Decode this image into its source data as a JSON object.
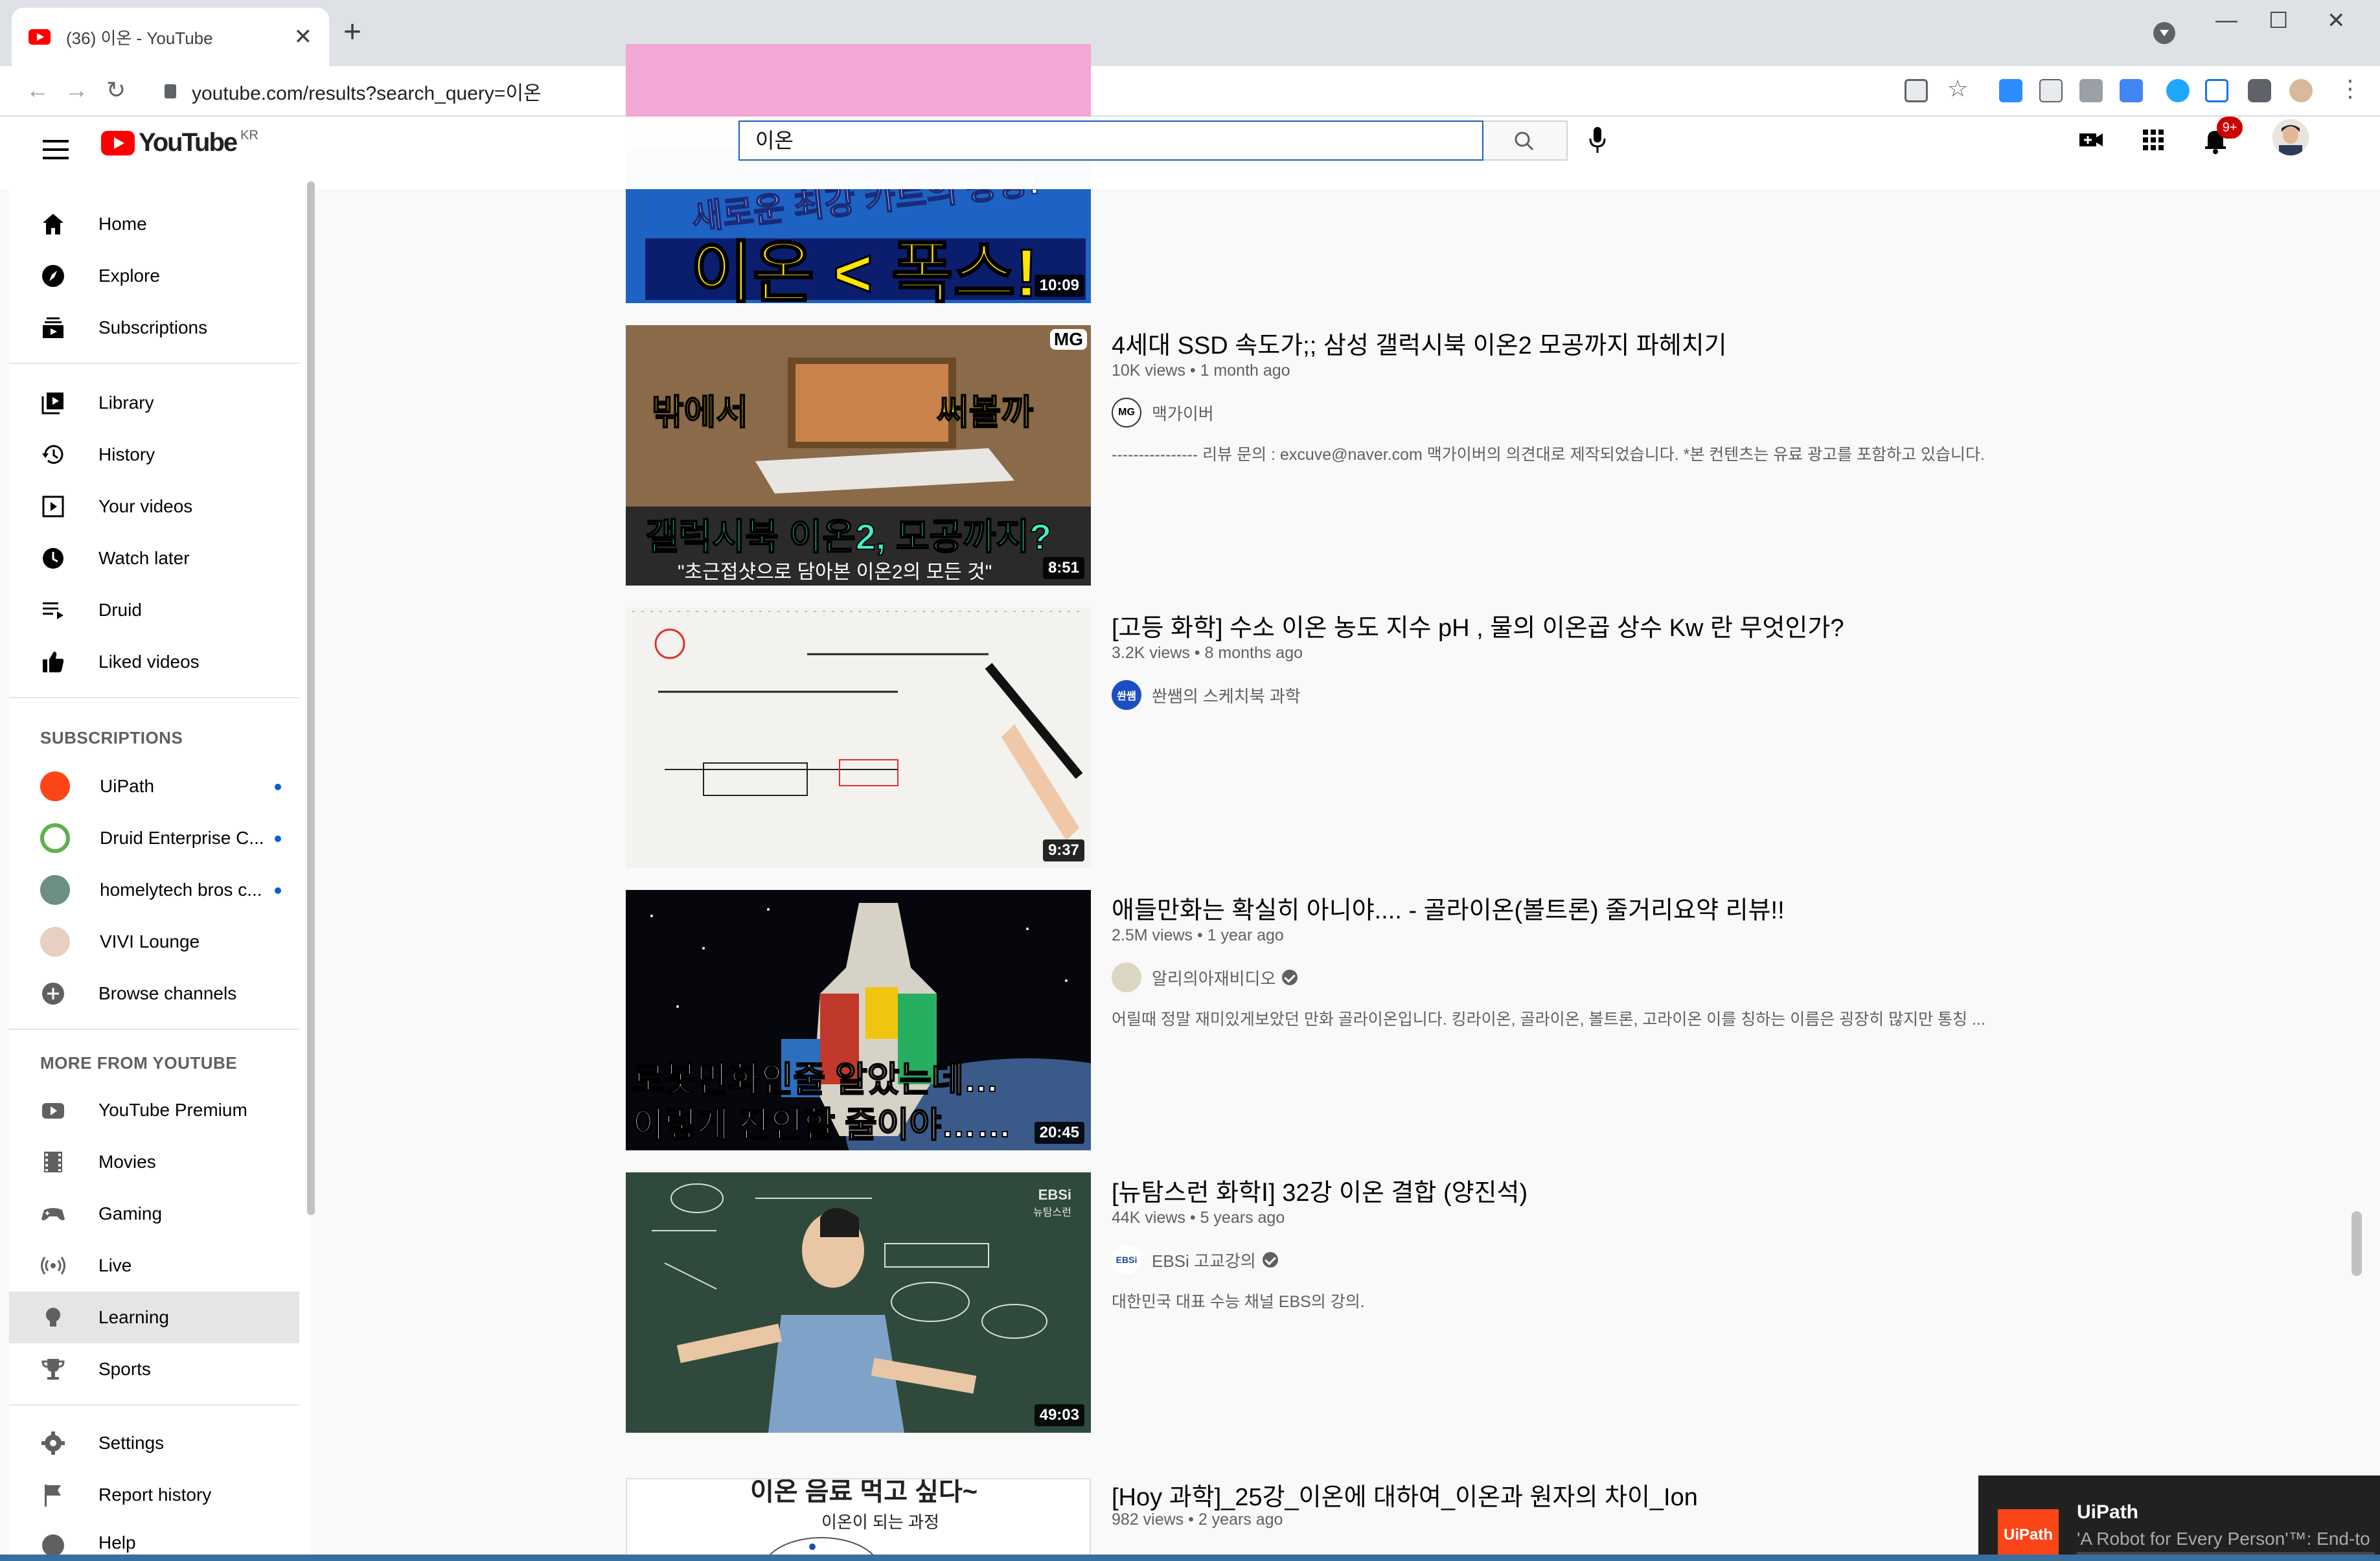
{
  "browser": {
    "tab_title": "(36) 이온 - YouTube",
    "tab_close": "✕",
    "new_tab": "+",
    "url": "youtube.com/results?search_query=이온",
    "minimize": "—",
    "maximize": "☐",
    "close": "✕"
  },
  "masthead": {
    "logo_text": "YouTube",
    "region": "KR",
    "search_value": "이온",
    "notification_count": "9+"
  },
  "sidebar": {
    "main": [
      {
        "label": "Home",
        "icon": "home-icon"
      },
      {
        "label": "Explore",
        "icon": "compass-icon"
      },
      {
        "label": "Subscriptions",
        "icon": "subscriptions-icon"
      }
    ],
    "library": [
      {
        "label": "Library",
        "icon": "library-icon"
      },
      {
        "label": "History",
        "icon": "history-icon"
      },
      {
        "label": "Your videos",
        "icon": "your-videos-icon"
      },
      {
        "label": "Watch later",
        "icon": "clock-icon"
      },
      {
        "label": "Druid",
        "icon": "playlist-icon"
      },
      {
        "label": "Liked videos",
        "icon": "thumbs-up-icon"
      }
    ],
    "subscriptions_heading": "SUBSCRIPTIONS",
    "subscriptions": [
      {
        "label": "UiPath",
        "new": true,
        "color": "#fa4616"
      },
      {
        "label": "Druid Enterprise C...",
        "new": true,
        "color": "#5fb04d"
      },
      {
        "label": "homelytech bros c...",
        "new": true,
        "color": "#6b8f80"
      },
      {
        "label": "VIVI Lounge",
        "new": false,
        "color": "#e7cfc4"
      },
      {
        "label": "Browse channels",
        "new": false,
        "color": "#606060"
      }
    ],
    "more_heading": "MORE FROM YOUTUBE",
    "more": [
      {
        "label": "YouTube Premium",
        "icon": "youtube-premium-icon"
      },
      {
        "label": "Movies",
        "icon": "film-icon"
      },
      {
        "label": "Gaming",
        "icon": "gamepad-icon"
      },
      {
        "label": "Live",
        "icon": "live-icon"
      },
      {
        "label": "Learning",
        "icon": "lightbulb-icon",
        "active": true
      },
      {
        "label": "Sports",
        "icon": "trophy-icon"
      }
    ],
    "bottom": [
      {
        "label": "Settings",
        "icon": "gear-icon"
      },
      {
        "label": "Report history",
        "icon": "flag-icon"
      },
      {
        "label": "Help",
        "icon": "help-icon"
      }
    ]
  },
  "results": [
    {
      "title": "",
      "meta": "",
      "channel": "",
      "description": "",
      "duration": "10:09",
      "thumb_text": [
        "새로운 최강 카트의 등장!",
        "이온 < 폭스!"
      ]
    },
    {
      "title": "4세대 SSD 속도가;; 삼성 갤럭시북 이온2 모공까지 파헤치기",
      "meta": "10K views • 1 month ago",
      "channel": "맥가이버",
      "channel_badge": "MG",
      "verified": false,
      "description": "---------------- 리뷰 문의 : excuve@naver.com 맥가이버의 의견대로 제작되었습니다. *본 컨텐츠는 유료 광고를 포함하고 있습니다.",
      "duration": "8:51",
      "thumb_text": [
        "밖에서",
        "써볼까",
        "갤럭시북 이온2, 모공까지?",
        "\"초근접샷으로 담아본 이온2의 모든 것\"",
        "MG"
      ]
    },
    {
      "title": "[고등 화학] 수소 이온 농도 지수 pH , 물의 이온곱 상수 Kw 란 무엇인가?",
      "meta": "3.2K views • 8 months ago",
      "channel": "쏸쌤의 스케치북 과학",
      "channel_badge": "쏸쌤",
      "verified": false,
      "description": "",
      "duration": "9:37",
      "thumb_text": []
    },
    {
      "title": "애들만화는 확실히 아니야.... - 골라이온(볼트론) 줄거리요약 리뷰!!",
      "meta": "2.5M views • 1 year ago",
      "channel": "알리의아재비디오",
      "channel_badge": "",
      "verified": true,
      "description": "어릴때 정말 재미있게보았던 만화 골라이온입니다. 킹라이온, 골라이온, 볼트론, 고라이온 이를 칭하는 이름은 굉장히 많지만 통칭 ...",
      "duration": "20:45",
      "thumb_text": [
        "로봇만화인줄 알았는데…",
        "이렇게 잔인할 줄이야……"
      ]
    },
    {
      "title": "[뉴탐스런 화학Ⅰ] 32강 이온 결합 (양진석)",
      "meta": "44K views • 5 years ago",
      "channel": "EBSi 고교강의",
      "channel_badge": "EBSi",
      "verified": true,
      "description": "대한민국 대표 수능 채널 EBS의 강의.",
      "duration": "49:03",
      "thumb_text": [
        "EBSi",
        "뉴탐스런"
      ]
    },
    {
      "title": "[Hoy 과학]_25강_이온에 대하여_이온과 원자의 차이_Ion",
      "meta": "982 views • 2 years ago",
      "channel": "",
      "description": "",
      "duration": "",
      "thumb_text": [
        "이온 음료 먹고 싶다~",
        "이온이 되는 과정"
      ]
    }
  ],
  "toast": {
    "logo": "UiPath",
    "title": "UiPath",
    "text": "'A Robot for Every Person'™: End-to"
  }
}
